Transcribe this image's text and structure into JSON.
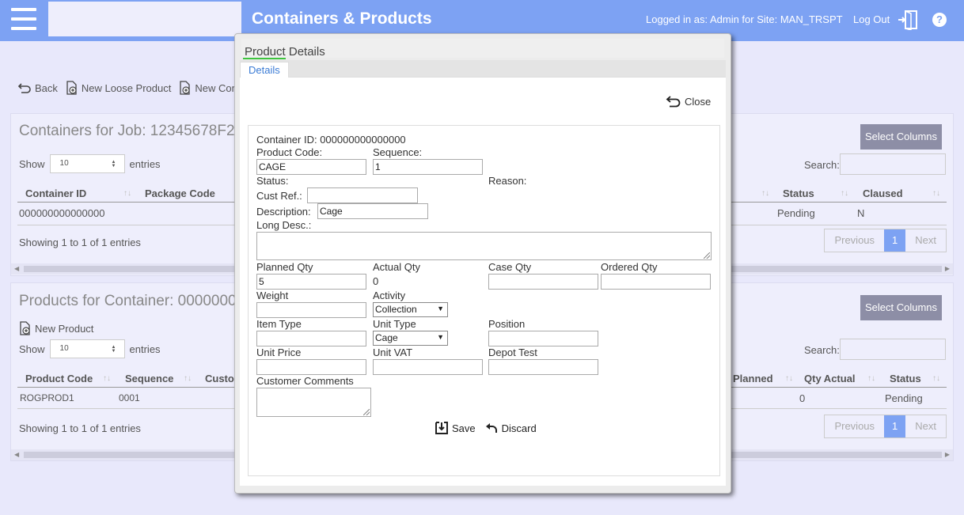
{
  "header": {
    "title": "Containers & Products",
    "logged_in": "Logged in as: Admin for Site: MAN_TRSPT",
    "logout": "Log Out",
    "help": "?"
  },
  "toolbar": {
    "back": "Back",
    "new_loose_product": "New Loose Product",
    "new_container": "New Cont"
  },
  "containers_panel": {
    "title": "Containers for Job: 12345678F2",
    "select_columns": "Select Columns",
    "show_label": "Show",
    "show_value": "10",
    "entries_label": "entries",
    "search_label": "Search:",
    "columns": [
      "Container ID",
      "Package Code",
      "Status",
      "Claused"
    ],
    "rows": [
      {
        "container_id": "000000000000000",
        "status": "Pending",
        "claused": "N"
      }
    ],
    "showing": "Showing 1 to 1 of 1 entries",
    "pager": {
      "previous": "Previous",
      "page": "1",
      "next": "Next"
    }
  },
  "products_panel": {
    "title": "Products for Container: 0000000",
    "select_columns": "Select Columns",
    "new_product": "New Product",
    "show_label": "Show",
    "show_value": "10",
    "entries_label": "entries",
    "search_label": "Search:",
    "columns": [
      "Product Code",
      "Sequence",
      "Custo",
      "Planned",
      "Qty Actual",
      "Status"
    ],
    "rows": [
      {
        "product_code": "ROGPROD1",
        "sequence": "0001",
        "qty_actual": "0",
        "status": "Pending"
      }
    ],
    "showing": "Showing 1 to 1 of 1 entries",
    "pager": {
      "previous": "Previous",
      "page": "1",
      "next": "Next"
    }
  },
  "modal": {
    "title": "Product Details",
    "tab": "Details",
    "close": "Close",
    "container_id": "Container ID: 000000000000000",
    "labels": {
      "product_code": "Product Code:",
      "sequence": "Sequence:",
      "status": "Status:",
      "reason": "Reason:",
      "cust_ref": "Cust Ref.:",
      "description": "Description:",
      "long_desc": "Long Desc.:",
      "planned_qty": "Planned Qty",
      "actual_qty": "Actual Qty",
      "case_qty": "Case Qty",
      "ordered_qty": "Ordered Qty",
      "weight": "Weight",
      "activity": "Activity",
      "item_type": "Item Type",
      "unit_type": "Unit Type",
      "position": "Position",
      "unit_price": "Unit Price",
      "unit_vat": "Unit VAT",
      "depot_test": "Depot Test",
      "customer_comments": "Customer Comments"
    },
    "values": {
      "product_code": "CAGE",
      "sequence": "1",
      "cust_ref": "",
      "description": "Cage",
      "planned_qty": "5",
      "actual_qty": "0",
      "case_qty": "",
      "ordered_qty": "",
      "weight": "",
      "activity": "Collection",
      "item_type": "",
      "unit_type": "Cage",
      "position": "",
      "unit_price": "",
      "unit_vat": "",
      "depot_test": ""
    },
    "save": "Save",
    "discard": "Discard"
  },
  "colors": {
    "header_bg": "#7da2f3",
    "page_bg": "#e8e8fb",
    "select_columns_bg": "#8d8ea6",
    "active_tab_underline": "#3ec43e"
  }
}
